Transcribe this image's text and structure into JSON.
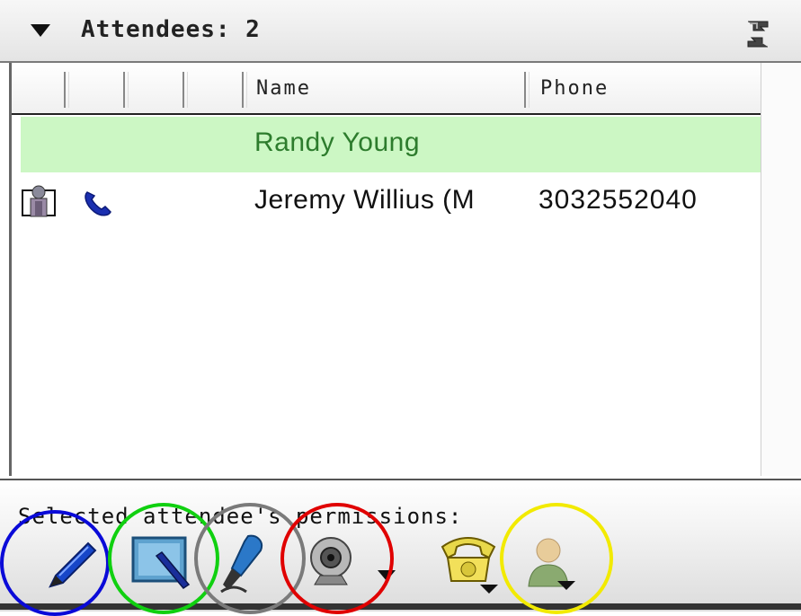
{
  "header": {
    "title": "Attendees: 2",
    "collapse_icon": "triangle-down-icon",
    "refresh_icon": "refresh-icon"
  },
  "columns": {
    "name": "Name",
    "phone": "Phone"
  },
  "attendees": [
    {
      "name": "Randy Young",
      "phone": "",
      "selected": true
    },
    {
      "name": "Jeremy Willius (M",
      "phone": "3032552040",
      "selected": false,
      "icons": [
        "attendee-presence-icon",
        "phone-handset-icon"
      ]
    }
  ],
  "footer": {
    "permissions_label": "Selected attendee's permissions:",
    "tools": [
      "annotate-pen-icon",
      "whiteboard-icon",
      "microphone-icon",
      "webcam-icon",
      "telephone-icon",
      "attendee-role-icon"
    ]
  },
  "highlight_colors": {
    "blue": "#0a0ad8",
    "green": "#10d010",
    "gray": "#7a7a7a",
    "red": "#e00000",
    "yellow": "#f2ea00"
  }
}
